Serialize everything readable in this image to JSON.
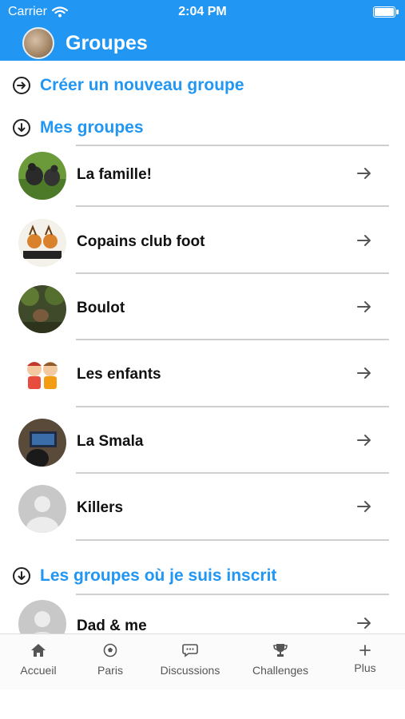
{
  "status_bar": {
    "carrier": "Carrier",
    "time": "2:04 PM"
  },
  "header": {
    "title": "Groupes"
  },
  "create_group": {
    "label": "Créer un nouveau groupe"
  },
  "my_groups": {
    "title": "Mes groupes",
    "items": [
      {
        "label": "La famille!"
      },
      {
        "label": "Copains club foot"
      },
      {
        "label": "Boulot"
      },
      {
        "label": "Les enfants"
      },
      {
        "label": "La Smala"
      },
      {
        "label": "Killers"
      }
    ]
  },
  "subscribed_groups": {
    "title": "Les groupes où je suis inscrit",
    "items": [
      {
        "label": "Dad & me"
      }
    ]
  },
  "tabs": [
    {
      "label": "Accueil",
      "icon": "home-icon"
    },
    {
      "label": "Paris",
      "icon": "soccer-ball-icon"
    },
    {
      "label": "Discussions",
      "icon": "chat-bubble-icon"
    },
    {
      "label": "Challenges",
      "icon": "trophy-icon"
    },
    {
      "label": "Plus",
      "icon": "plus-icon"
    }
  ],
  "colors": {
    "accent": "#2196f3",
    "divider": "#cfcfcf",
    "text": "#111111"
  }
}
